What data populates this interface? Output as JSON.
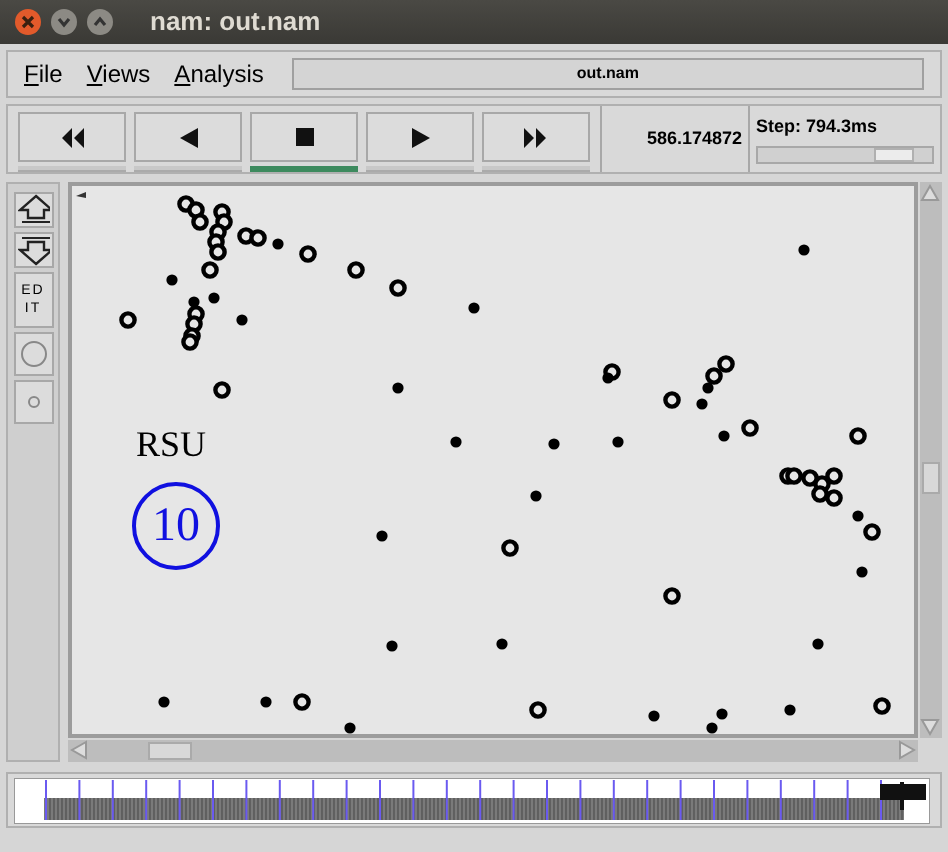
{
  "window": {
    "title": "nam: out.nam"
  },
  "menu": [
    {
      "label": "File"
    },
    {
      "label": "Views"
    },
    {
      "label": "Analysis"
    }
  ],
  "file_label": "out.nam",
  "controls": [
    {
      "kind": "rewind",
      "selected": false
    },
    {
      "kind": "back",
      "selected": false
    },
    {
      "kind": "stop",
      "selected": true
    },
    {
      "kind": "play",
      "selected": false
    },
    {
      "kind": "fast_forward",
      "selected": false
    }
  ],
  "time": "586.174872",
  "step": {
    "label": "Step: 794.3ms",
    "level": 0.9
  },
  "tools": [
    {
      "kind": "zoom_in"
    },
    {
      "kind": "zoom_out"
    },
    {
      "kind": "edit",
      "label": "EDIT"
    },
    {
      "kind": "large_node"
    },
    {
      "kind": "small_node"
    }
  ],
  "canvas": {
    "rsu_label": "RSU",
    "rsu_node": "10"
  }
}
